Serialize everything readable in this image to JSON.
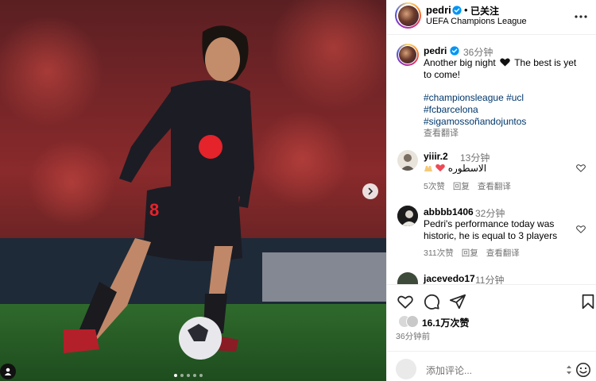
{
  "post": {
    "username": "pedri",
    "follow_label": "已关注",
    "header_dot": "•",
    "location": "UEFA Champions League",
    "caption_time": "36分钟",
    "caption_line1": "Another big night",
    "caption_line1_end": "The best is yet",
    "caption_line2": "to come!",
    "hashtags": [
      "#championsleague #ucl",
      "#fcbarcelona",
      "#sigamossoñandojuntos"
    ],
    "see_translation": "查看翻译",
    "photo_jersey_number": "8"
  },
  "comments": [
    {
      "username": "yiiir.2",
      "time": "13分钟",
      "text": "الاسطوره",
      "likes": "5次赞",
      "reply": "回复",
      "translate": "查看翻译"
    },
    {
      "username": "abbbb1406",
      "time": "32分钟",
      "text_line1": "Pedri's performance today was",
      "text_line2": "historic, he is equal to 3 players",
      "likes": "311次赞",
      "reply": "回复",
      "translate": "查看翻译"
    },
    {
      "username": "jacevedo17",
      "time": "11分钟"
    }
  ],
  "footer": {
    "likes_count": "16.1万次赞",
    "post_time": "36分钟前",
    "comment_placeholder": "添加评论..."
  },
  "carousel": {
    "total": 5,
    "active": 0
  },
  "icons": {
    "verified": "verified-badge-icon",
    "more": "more-options-icon",
    "heart": "heart-icon",
    "comment": "comment-icon",
    "share": "share-icon",
    "save": "bookmark-icon",
    "emoji": "emoji-icon",
    "next": "chevron-right-icon",
    "tag": "user-tag-icon"
  },
  "colors": {
    "link": "#00376b",
    "verified": "#0095f6",
    "muted": "#737373",
    "heart_red": "#ed4956"
  }
}
